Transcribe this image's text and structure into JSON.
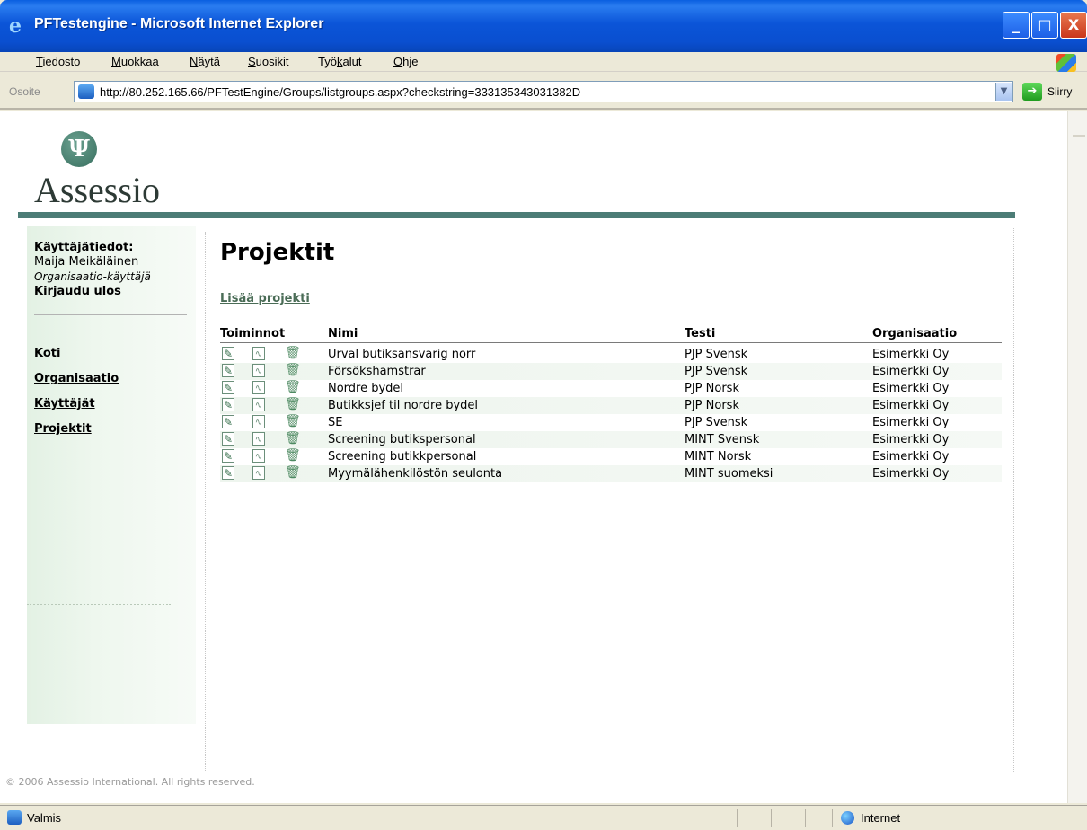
{
  "window": {
    "title": "PFTestengine - Microsoft Internet Explorer",
    "controls": {
      "minimize": "_",
      "maximize": "□",
      "close": "X"
    }
  },
  "menubar": {
    "items": [
      {
        "label": "Tiedosto",
        "accel": "T",
        "rest": "iedosto"
      },
      {
        "label": "Muokkaa",
        "accel": "M",
        "rest": "uokkaa"
      },
      {
        "label": "Näytä",
        "accel": "N",
        "rest": "äytä"
      },
      {
        "label": "Suosikit",
        "accel": "S",
        "rest": "uosikit"
      },
      {
        "label": "Työkalut",
        "accel": "k",
        "pre": "Työ",
        "rest": "alut"
      },
      {
        "label": "Ohje",
        "accel": "O",
        "rest": "hje"
      }
    ]
  },
  "addressbar": {
    "label": "Osoite",
    "url": "http://80.252.165.66/PFTestEngine/Groups/listgroups.aspx?checkstring=333135343031382D",
    "go_label": "Siirry"
  },
  "brand": {
    "name": "Assessio",
    "symbol": "Ψ",
    "accent": "#4c7c76"
  },
  "sidebar": {
    "user_heading": "Käyttäjätiedot:",
    "user_name": "Maija Meikäläinen",
    "user_role": "Organisaatio-käyttäjä",
    "logout": "Kirjaudu ulos",
    "nav": [
      {
        "label": "Koti"
      },
      {
        "label": "Organisaatio"
      },
      {
        "label": "Käyttäjät"
      },
      {
        "label": "Projektit"
      }
    ]
  },
  "main": {
    "title": "Projektit",
    "add_link": "Lisää projekti",
    "columns": [
      "Toiminnot",
      "Nimi",
      "Testi",
      "Organisaatio"
    ],
    "rows": [
      {
        "nimi": "Urval butiksansvarig norr",
        "testi": "PJP Svensk",
        "organisaatio": "Esimerkki Oy"
      },
      {
        "nimi": "Försökshamstrar",
        "testi": "PJP Svensk",
        "organisaatio": "Esimerkki Oy"
      },
      {
        "nimi": "Nordre bydel",
        "testi": "PJP Norsk",
        "organisaatio": "Esimerkki Oy"
      },
      {
        "nimi": "Butikksjef til nordre bydel",
        "testi": "PJP Norsk",
        "organisaatio": "Esimerkki Oy"
      },
      {
        "nimi": "SE",
        "testi": "PJP Svensk",
        "organisaatio": "Esimerkki Oy"
      },
      {
        "nimi": "Screening butikspersonal",
        "testi": "MINT Svensk",
        "organisaatio": "Esimerkki Oy"
      },
      {
        "nimi": "Screening butikkpersonal",
        "testi": "MINT Norsk",
        "organisaatio": "Esimerkki Oy"
      },
      {
        "nimi": "Myymälähenkilöstön seulonta",
        "testi": "MINT suomeksi",
        "organisaatio": "Esimerkki Oy"
      }
    ],
    "action_icons": [
      "edit-icon",
      "chart-icon",
      "trash-icon"
    ]
  },
  "footer": "© 2006 Assessio International. All rights reserved.",
  "statusbar": {
    "text": "Valmis",
    "zone": "Internet"
  }
}
